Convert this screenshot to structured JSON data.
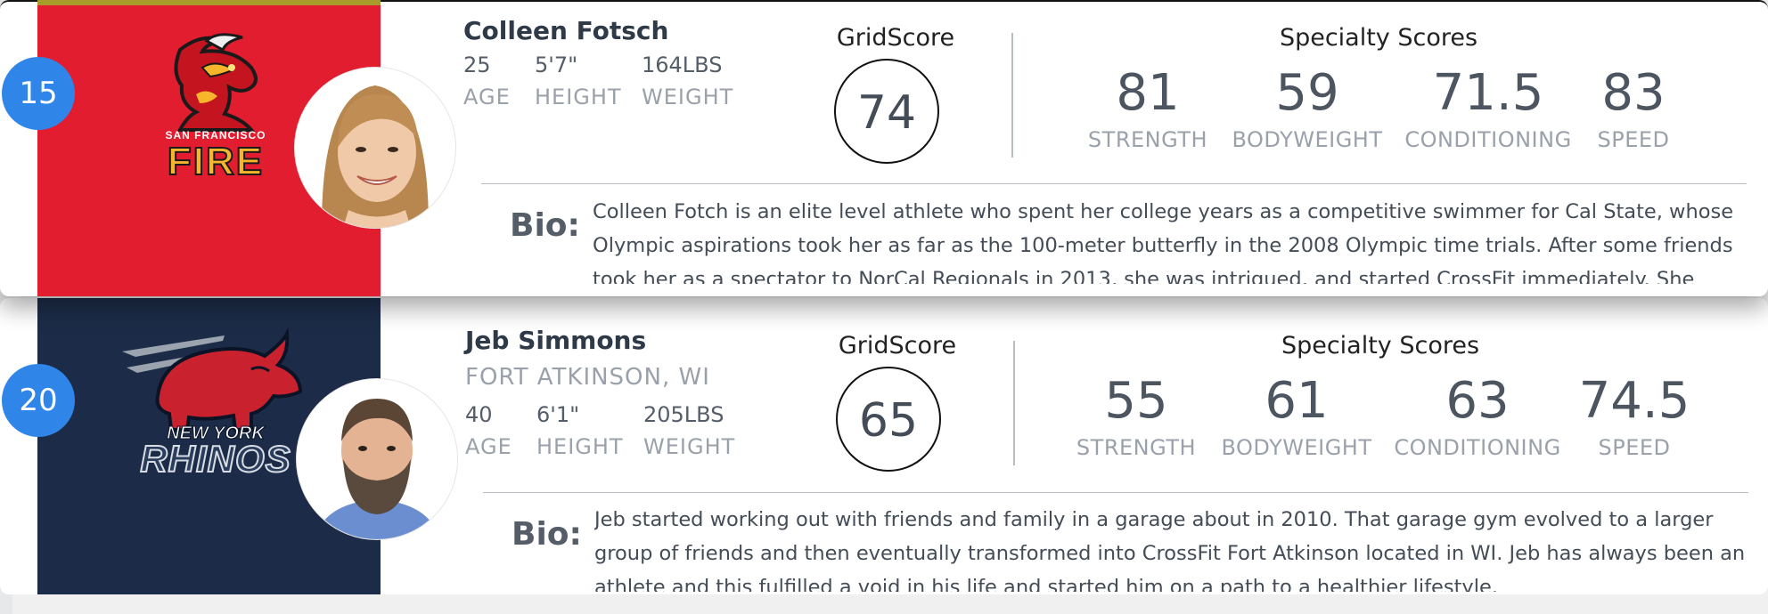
{
  "players": [
    {
      "rank": "15",
      "name": "Colleen Fotsch",
      "location": "",
      "team": {
        "name": "San Francisco Fire",
        "logo_top_text": "SAN FRANCISCO",
        "logo_main_text": "FIRE",
        "panel_color": "#e11d2f"
      },
      "stats": [
        {
          "value": "25",
          "label": "AGE"
        },
        {
          "value": "5'7\"",
          "label": "HEIGHT"
        },
        {
          "value": "164LBS",
          "label": "WEIGHT"
        }
      ],
      "gridscore_title": "GridScore",
      "gridscore": "74",
      "specialty_title": "Specialty Scores",
      "specialty": [
        {
          "value": "81",
          "label": "STRENGTH"
        },
        {
          "value": "59",
          "label": "BODYWEIGHT"
        },
        {
          "value": "71.5",
          "label": "CONDITIONING"
        },
        {
          "value": "83",
          "label": "SPEED"
        }
      ],
      "bio_label": "Bio:",
      "bio": "Colleen Fotch is an elite level athlete who spent her college years as a competitive swimmer for Cal State, whose Olympic aspirations took her as far as the 100-meter butterfly in the 2008 Olympic time trials. After some friends took her as a spectator to NorCal Regionals in 2013, she was intrigued, and started CrossFit immediately. She"
    },
    {
      "rank": "20",
      "name": "Jeb Simmons",
      "location": "FORT ATKINSON, WI",
      "team": {
        "name": "New York Rhinos",
        "logo_top_text": "NEW YORK",
        "logo_main_text": "RHINOS",
        "panel_color": "#1c2c48"
      },
      "stats": [
        {
          "value": "40",
          "label": "AGE"
        },
        {
          "value": "6'1\"",
          "label": "HEIGHT"
        },
        {
          "value": "205LBS",
          "label": "WEIGHT"
        }
      ],
      "gridscore_title": "GridScore",
      "gridscore": "65",
      "specialty_title": "Specialty Scores",
      "specialty": [
        {
          "value": "55",
          "label": "STRENGTH"
        },
        {
          "value": "61",
          "label": "BODYWEIGHT"
        },
        {
          "value": "63",
          "label": "CONDITIONING"
        },
        {
          "value": "74.5",
          "label": "SPEED"
        }
      ],
      "bio_label": "Bio:",
      "bio": "Jeb started working out with friends and family in a garage about in 2010. That garage gym evolved to a larger group of friends and then eventually transformed into CrossFit Fort Atkinson located in WI. Jeb has always been an athlete and this fulfilled a void in his life and started him on a path to a healthier lifestyle."
    }
  ]
}
